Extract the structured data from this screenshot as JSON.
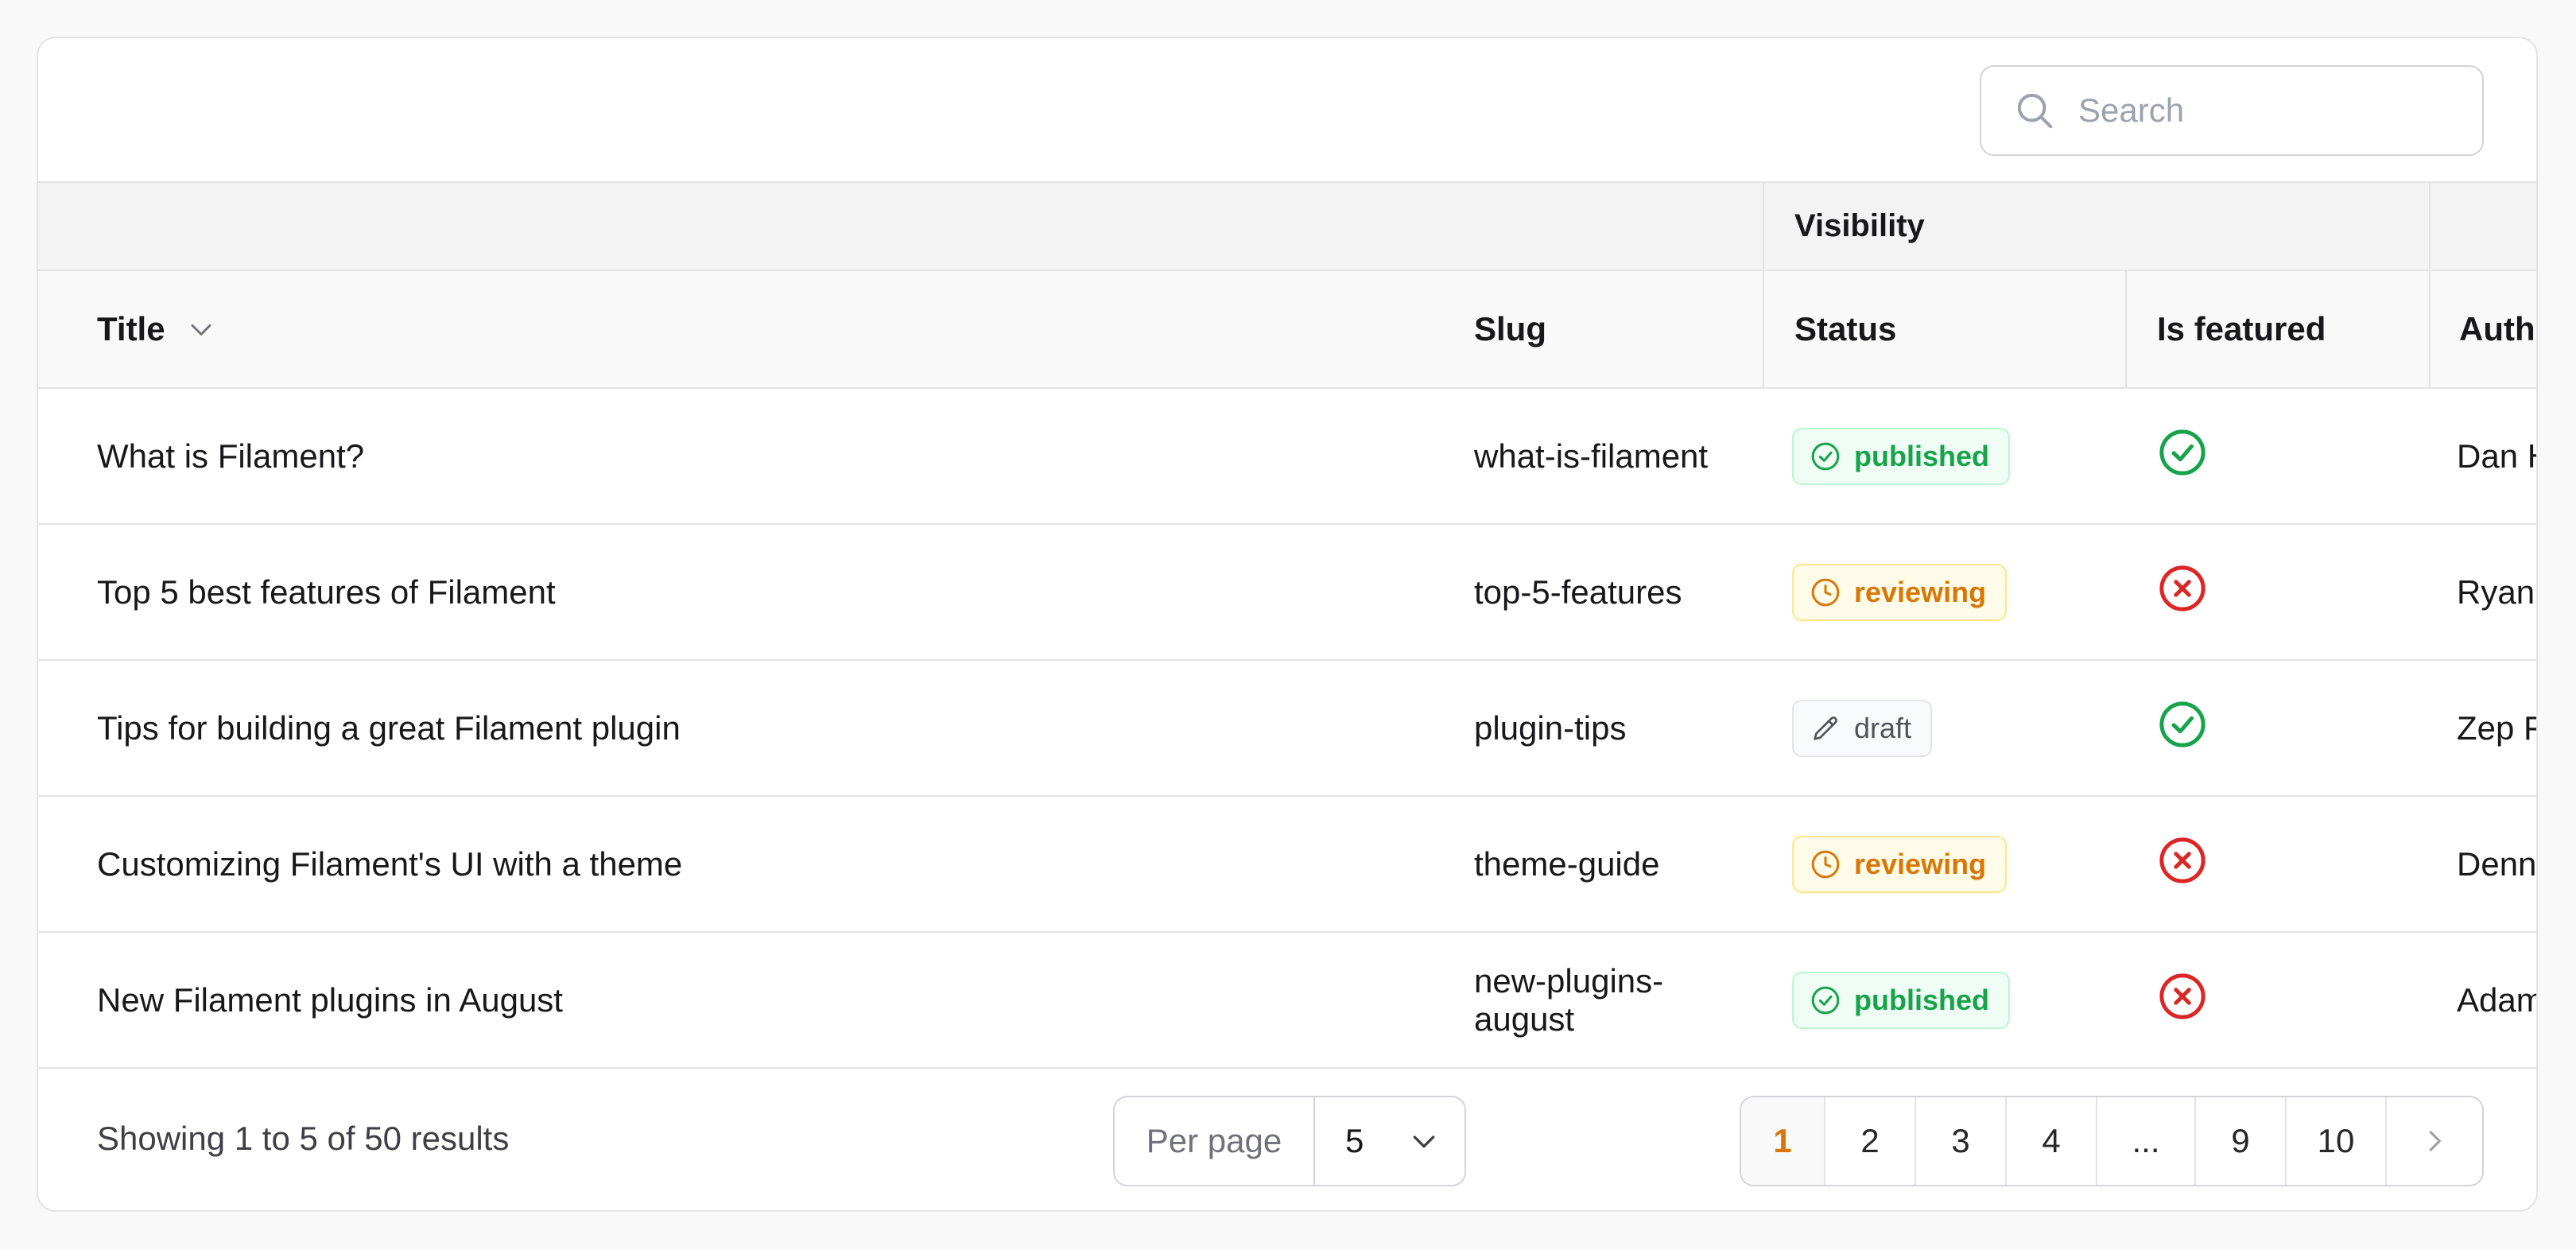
{
  "search": {
    "placeholder": "Search"
  },
  "table": {
    "group_header": "Visibility",
    "columns": {
      "title": "Title",
      "slug": "Slug",
      "status": "Status",
      "featured": "Is featured",
      "author": "Author"
    },
    "rows": [
      {
        "title": "What is Filament?",
        "slug": "what-is-filament",
        "status": "published",
        "featured": true,
        "author": "Dan Harrin"
      },
      {
        "title": "Top 5 best features of Filament",
        "slug": "top-5-features",
        "status": "reviewing",
        "featured": false,
        "author": "Ryan Chandler"
      },
      {
        "title": "Tips for building a great Filament plugin",
        "slug": "plugin-tips",
        "status": "draft",
        "featured": true,
        "author": "Zep Fietje"
      },
      {
        "title": "Customizing Filament's UI with a theme",
        "slug": "theme-guide",
        "status": "reviewing",
        "featured": false,
        "author": "Dennis Koch"
      },
      {
        "title": "New Filament plugins in August",
        "slug": "new-plugins-august",
        "status": "published",
        "featured": false,
        "author": "Adam Weston"
      }
    ]
  },
  "footer": {
    "summary": "Showing 1 to 5 of 50 results",
    "per_page_label": "Per page",
    "per_page_value": "5",
    "pages": [
      "1",
      "2",
      "3",
      "4",
      "...",
      "9",
      "10"
    ],
    "current_page": "1"
  },
  "colors": {
    "published": "#16a34a",
    "reviewing": "#d97706",
    "draft": "#52525b",
    "featured_true": "#16a34a",
    "featured_false": "#dc2626",
    "active_page": "#d97706"
  },
  "icons": {
    "published": "check-circle-icon",
    "reviewing": "clock-icon",
    "draft": "pencil-icon",
    "featured_true": "check-circle-icon",
    "featured_false": "x-circle-icon"
  }
}
